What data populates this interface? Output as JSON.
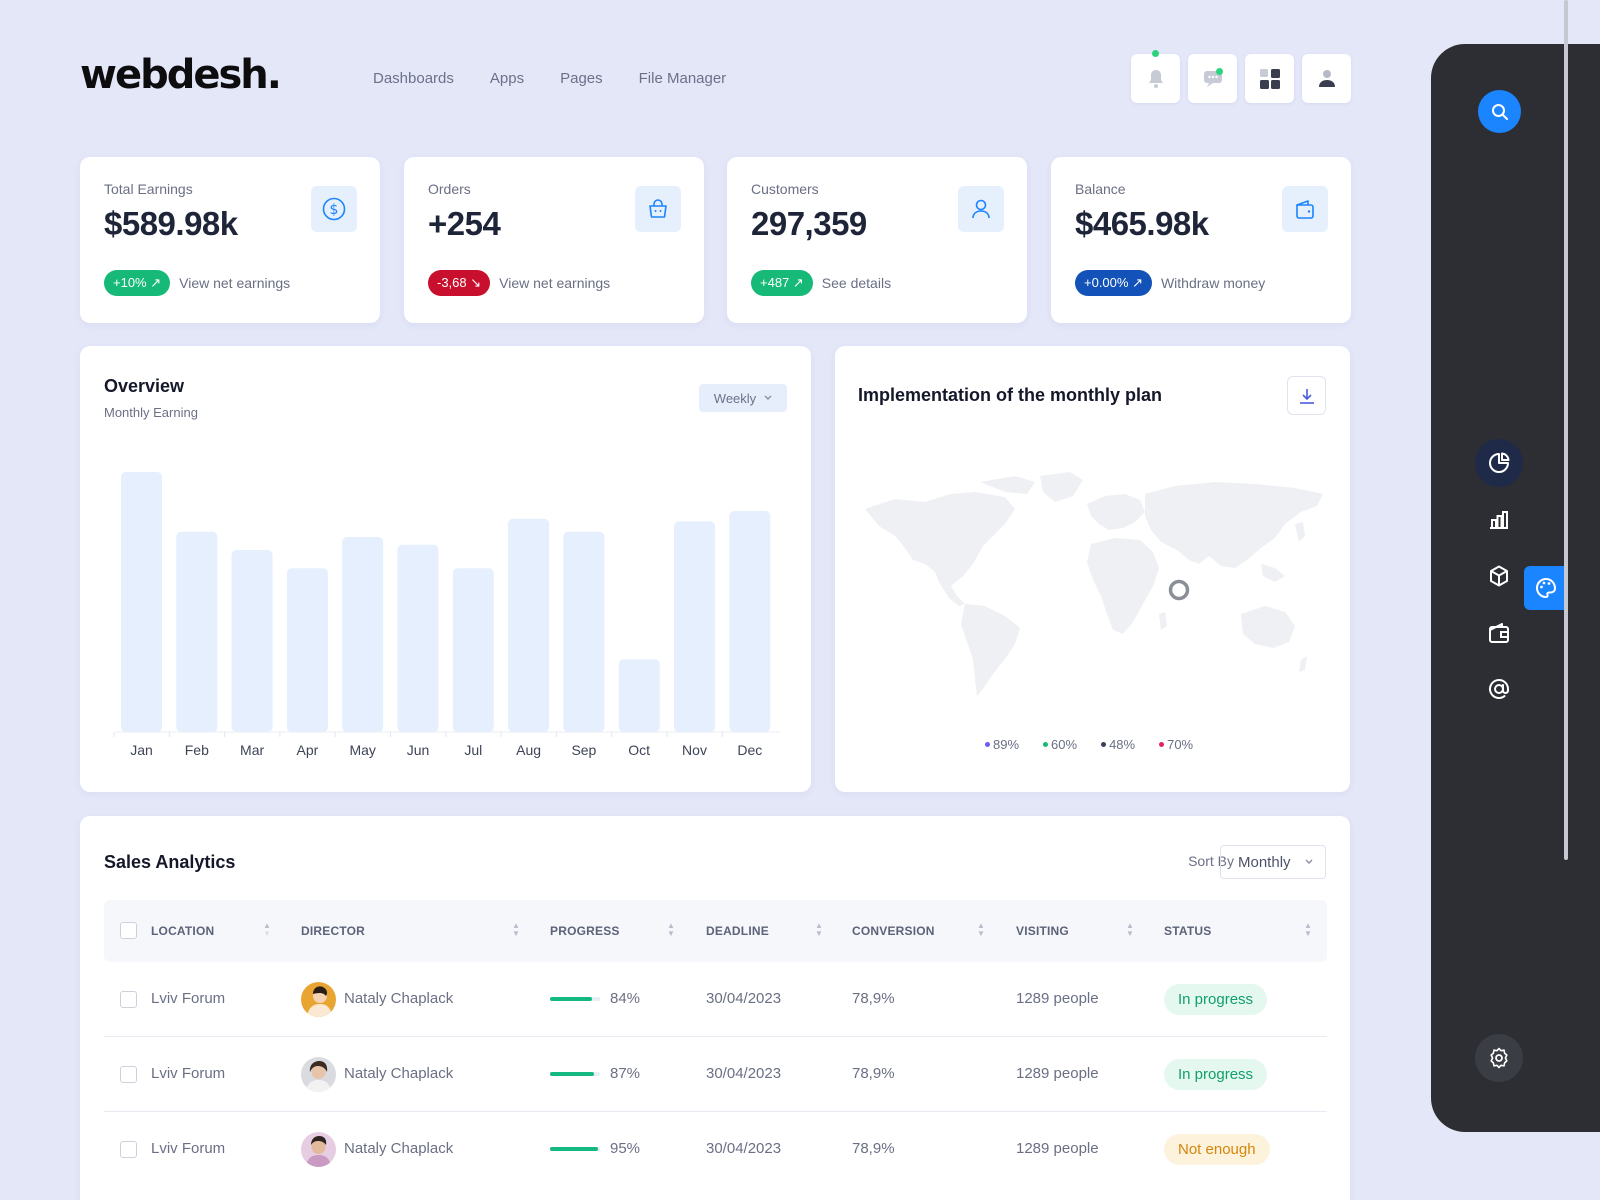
{
  "app": {
    "logo": "webdesh."
  },
  "nav": [
    "Dashboards",
    "Apps",
    "Pages",
    "File Manager"
  ],
  "header_icons": [
    "bell-icon",
    "chat-icon",
    "apps-grid-icon",
    "user-icon"
  ],
  "stats": [
    {
      "label": "Total Earnings",
      "value": "$589.98k",
      "badge": "+10% ↗",
      "badge_color": "#17b978",
      "link": "View net earnings",
      "icon": "dollar-icon"
    },
    {
      "label": "Orders",
      "value": "+254",
      "badge": "-3,68 ↘",
      "badge_color": "#c8102e",
      "link": "View net earnings",
      "icon": "basket-icon"
    },
    {
      "label": "Customers",
      "value": "297,359",
      "badge": "+487 ↗",
      "badge_color": "#17b978",
      "link": "See details",
      "icon": "user-icon"
    },
    {
      "label": "Balance",
      "value": "$465.98k",
      "badge": "+0.00% ↗",
      "badge_color": "#1352b8",
      "link": "Withdraw money",
      "icon": "wallet-icon"
    }
  ],
  "overview": {
    "title": "Overview",
    "subtitle": "Monthly Earning",
    "period": "Weekly"
  },
  "chart_data": {
    "type": "bar",
    "categories": [
      "Jan",
      "Feb",
      "Mar",
      "Apr",
      "May",
      "Jun",
      "Jul",
      "Aug",
      "Sep",
      "Oct",
      "Nov",
      "Dec"
    ],
    "values": [
      100,
      77,
      70,
      63,
      75,
      72,
      63,
      82,
      77,
      28,
      81,
      85
    ],
    "title": "Overview",
    "subtitle": "Monthly Earning",
    "xlabel": "",
    "ylabel": "",
    "ylim": [
      0,
      100
    ],
    "grid": false,
    "bar_color": "#e5effd"
  },
  "map_panel": {
    "title": "Implementation of the monthly plan",
    "legend": [
      {
        "label": "89%",
        "color": "#6a5cf0"
      },
      {
        "label": "60%",
        "color": "#17b978"
      },
      {
        "label": "48%",
        "color": "#3b3f55"
      },
      {
        "label": "70%",
        "color": "#e0245e"
      }
    ]
  },
  "sales": {
    "title": "Sales Analytics",
    "sort_label": "Sort By",
    "sort_value": "Monthly",
    "columns": [
      "LOCATION",
      "DIRECTOR",
      "PROGRESS",
      "DEADLINE",
      "CONVERSION",
      "VISITING",
      "STATUS"
    ],
    "rows": [
      {
        "location": "Lviv Forum",
        "director": "Nataly Chaplack",
        "progress": "84%",
        "progress_value": 84,
        "deadline": "30/04/2023",
        "conversion": "78,9%",
        "visiting": "1289 people",
        "status": "In progress",
        "status_bg": "#e5f8f0",
        "status_color": "#11a06a",
        "avatar_color": "#e8a532"
      },
      {
        "location": "Lviv Forum",
        "director": "Nataly Chaplack",
        "progress": "87%",
        "progress_value": 87,
        "deadline": "30/04/2023",
        "conversion": "78,9%",
        "visiting": "1289 people",
        "status": "In progress",
        "status_bg": "#e5f8f0",
        "status_color": "#11a06a",
        "avatar_color": "#9aa0ab"
      },
      {
        "location": "Lviv Forum",
        "director": "Nataly Chaplack",
        "progress": "95%",
        "progress_value": 95,
        "deadline": "30/04/2023",
        "conversion": "78,9%",
        "visiting": "1289 people",
        "status": "Not enough",
        "status_bg": "#fdf3dd",
        "status_color": "#d4860b",
        "avatar_color": "#c99bc3"
      }
    ]
  },
  "sidebar": {
    "icons": [
      "search-icon",
      "pie-chart-icon",
      "bar-chart-icon",
      "cube-icon",
      "wallet-icon",
      "at-sign-icon",
      "palette-icon",
      "settings-icon"
    ]
  },
  "colors": {
    "accent": "#1b84ff",
    "page_bg": "#e3e7f8",
    "sidebar_bg": "#2c2e33"
  }
}
